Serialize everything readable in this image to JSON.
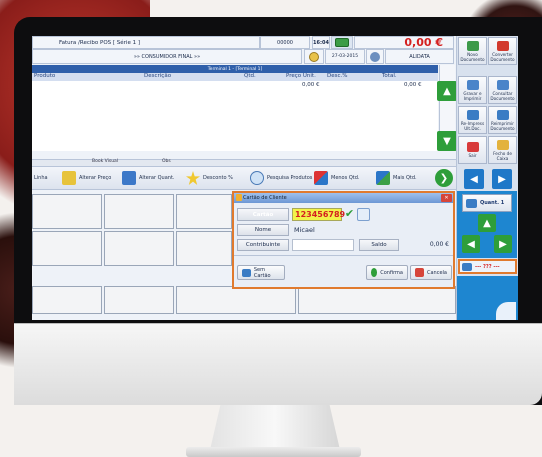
{
  "pos": {
    "doc_type": "Fatura /Recibo POS [ Série 1 ]",
    "code": "00000",
    "time": "16:04",
    "total": "0,00 €",
    "customer": "»» CONSUMIDOR FINAL »»",
    "date": "27-03-2015",
    "user": "ALIDATA",
    "terminal": "Terminal 1 - [Terminal 1]",
    "columns": [
      "Produto",
      "Descrição",
      "Qtd.",
      "Preço Unit.",
      "Desc.%",
      "Total."
    ],
    "row_price": "0,00 €",
    "row_total": "0,00 €",
    "tabs": [
      "Book Visual",
      "Obs"
    ],
    "toolbar": [
      "Linha",
      "Alterar Preço",
      "Alterar Quant.",
      "Desconto %",
      "Pesquisa Produtos",
      "Menos Qtd.",
      "Mais Qtd."
    ],
    "side": {
      "novo_doc": "Novo Documento",
      "converter": "Converter Documento",
      "gravar": "Gravar e Imprimir",
      "consultar": "Consultar Documento",
      "reimpressao": "Re-Impress Ult.Doc.",
      "reimprimir": "Reimprimir Documento",
      "sair": "Sair",
      "fecho": "Fecho de Caixa",
      "quant": "Quant. 1",
      "status": "--- ??? ---"
    }
  },
  "dialog": {
    "title": "Cartão de Cliente",
    "card_label": "Cartão",
    "card_value": "123456789",
    "name_label": "Nome",
    "name_value": "Micael",
    "contrib_label": "Contribuinte",
    "saldo_label": "Saldo",
    "saldo_value": "0,00 €",
    "sem_cartao": "Sem Cartão",
    "confirma": "Confirma",
    "cancela": "Cancela"
  },
  "colors": {
    "accent_orange": "#e07a2e",
    "total_red": "#d42020",
    "green": "#2e9e3a",
    "blue": "#1f78c8"
  }
}
